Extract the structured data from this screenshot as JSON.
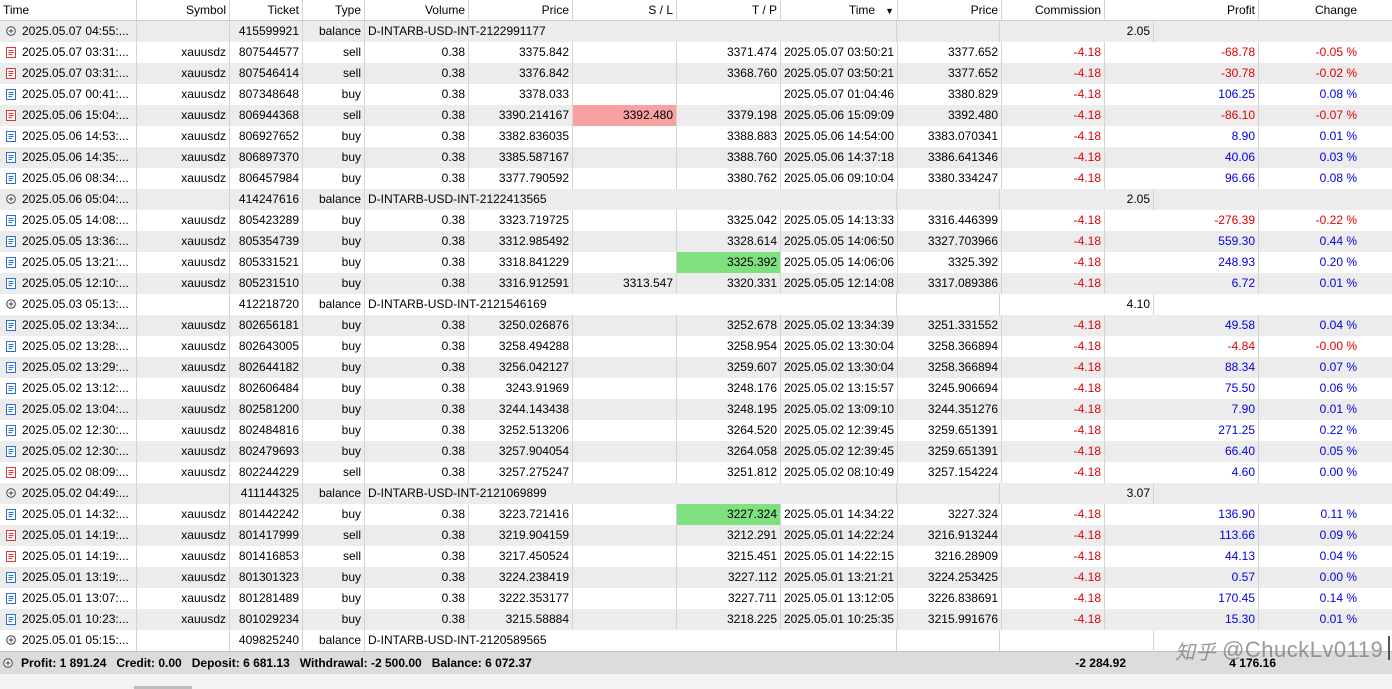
{
  "columns": [
    {
      "key": "time",
      "label": "Time",
      "align": "l"
    },
    {
      "key": "symbol",
      "label": "Symbol",
      "align": "r"
    },
    {
      "key": "ticket",
      "label": "Ticket",
      "align": "r"
    },
    {
      "key": "type",
      "label": "Type",
      "align": "r"
    },
    {
      "key": "volume",
      "label": "Volume",
      "align": "r"
    },
    {
      "key": "price",
      "label": "Price",
      "align": "r"
    },
    {
      "key": "sl",
      "label": "S / L",
      "align": "r"
    },
    {
      "key": "tp",
      "label": "T / P",
      "align": "r"
    },
    {
      "key": "time2",
      "label": "Time",
      "align": "r"
    },
    {
      "key": "price2",
      "label": "Price",
      "align": "r"
    },
    {
      "key": "commission",
      "label": "Commission",
      "align": "r"
    },
    {
      "key": "profit",
      "label": "Profit",
      "align": "r"
    },
    {
      "key": "change",
      "label": "Change",
      "align": "r"
    }
  ],
  "sort_indicator": "▼",
  "colors": {
    "loss": "#e00000",
    "gain": "#0000dd",
    "sl_hit": "#f7a1a1",
    "tp_hit": "#7ee07e",
    "alt_row": "#ececec"
  },
  "rows": [
    {
      "kind": "balance",
      "icon": "plus-circle",
      "time": "2025.05.07 04:55:...",
      "ticket": "415599921",
      "type": "balance",
      "comment": "D-INTARB-USD-INT-2122991177",
      "profit": "2.05"
    },
    {
      "kind": "trade",
      "icon": "sell",
      "time": "2025.05.07 03:31:...",
      "symbol": "xauusdz",
      "ticket": "807544577",
      "type": "sell",
      "volume": "0.38",
      "price": "3375.842",
      "sl": "",
      "tp": "3371.474",
      "time2": "2025.05.07 03:50:21",
      "price2": "3377.652",
      "commission": "-4.18",
      "profit": "-68.78",
      "change": "-0.05 %"
    },
    {
      "kind": "trade",
      "icon": "sell",
      "time": "2025.05.07 03:31:...",
      "symbol": "xauusdz",
      "ticket": "807546414",
      "type": "sell",
      "volume": "0.38",
      "price": "3376.842",
      "sl": "",
      "tp": "3368.760",
      "time2": "2025.05.07 03:50:21",
      "price2": "3377.652",
      "commission": "-4.18",
      "profit": "-30.78",
      "change": "-0.02 %"
    },
    {
      "kind": "trade",
      "icon": "buy",
      "time": "2025.05.07 00:41:...",
      "symbol": "xauusdz",
      "ticket": "807348648",
      "type": "buy",
      "volume": "0.38",
      "price": "3378.033",
      "sl": "",
      "tp": "",
      "time2": "2025.05.07 01:04:46",
      "price2": "3380.829",
      "commission": "-4.18",
      "profit": "106.25",
      "change": "0.08 %"
    },
    {
      "kind": "trade",
      "icon": "sell",
      "time": "2025.05.06 15:04:...",
      "symbol": "xauusdz",
      "ticket": "806944368",
      "type": "sell",
      "volume": "0.38",
      "price": "3390.214167",
      "sl": "3392.480",
      "sl_hit": true,
      "tp": "3379.198",
      "time2": "2025.05.06 15:09:09",
      "price2": "3392.480",
      "commission": "-4.18",
      "profit": "-86.10",
      "change": "-0.07 %"
    },
    {
      "kind": "trade",
      "icon": "buy",
      "time": "2025.05.06 14:53:...",
      "symbol": "xauusdz",
      "ticket": "806927652",
      "type": "buy",
      "volume": "0.38",
      "price": "3382.836035",
      "sl": "",
      "tp": "3388.883",
      "time2": "2025.05.06 14:54:00",
      "price2": "3383.070341",
      "commission": "-4.18",
      "profit": "8.90",
      "change": "0.01 %"
    },
    {
      "kind": "trade",
      "icon": "buy",
      "time": "2025.05.06 14:35:...",
      "symbol": "xauusdz",
      "ticket": "806897370",
      "type": "buy",
      "volume": "0.38",
      "price": "3385.587167",
      "sl": "",
      "tp": "3388.760",
      "time2": "2025.05.06 14:37:18",
      "price2": "3386.641346",
      "commission": "-4.18",
      "profit": "40.06",
      "change": "0.03 %"
    },
    {
      "kind": "trade",
      "icon": "buy",
      "time": "2025.05.06 08:34:...",
      "symbol": "xauusdz",
      "ticket": "806457984",
      "type": "buy",
      "volume": "0.38",
      "price": "3377.790592",
      "sl": "",
      "tp": "3380.762",
      "time2": "2025.05.06 09:10:04",
      "price2": "3380.334247",
      "commission": "-4.18",
      "profit": "96.66",
      "change": "0.08 %"
    },
    {
      "kind": "balance",
      "icon": "plus-circle",
      "time": "2025.05.06 05:04:...",
      "ticket": "414247616",
      "type": "balance",
      "comment": "D-INTARB-USD-INT-2122413565",
      "profit": "2.05"
    },
    {
      "kind": "trade",
      "icon": "buy",
      "time": "2025.05.05 14:08:...",
      "symbol": "xauusdz",
      "ticket": "805423289",
      "type": "buy",
      "volume": "0.38",
      "price": "3323.719725",
      "sl": "",
      "tp": "3325.042",
      "time2": "2025.05.05 14:13:33",
      "price2": "3316.446399",
      "commission": "-4.18",
      "profit": "-276.39",
      "change": "-0.22 %"
    },
    {
      "kind": "trade",
      "icon": "buy",
      "time": "2025.05.05 13:36:...",
      "symbol": "xauusdz",
      "ticket": "805354739",
      "type": "buy",
      "volume": "0.38",
      "price": "3312.985492",
      "sl": "",
      "tp": "3328.614",
      "time2": "2025.05.05 14:06:50",
      "price2": "3327.703966",
      "commission": "-4.18",
      "profit": "559.30",
      "change": "0.44 %"
    },
    {
      "kind": "trade",
      "icon": "buy",
      "time": "2025.05.05 13:21:...",
      "symbol": "xauusdz",
      "ticket": "805331521",
      "type": "buy",
      "volume": "0.38",
      "price": "3318.841229",
      "sl": "",
      "tp": "3325.392",
      "tp_hit": true,
      "time2": "2025.05.05 14:06:06",
      "price2": "3325.392",
      "commission": "-4.18",
      "profit": "248.93",
      "change": "0.20 %"
    },
    {
      "kind": "trade",
      "icon": "buy",
      "time": "2025.05.05 12:10:...",
      "symbol": "xauusdz",
      "ticket": "805231510",
      "type": "buy",
      "volume": "0.38",
      "price": "3316.912591",
      "sl": "3313.547",
      "tp": "3320.331",
      "time2": "2025.05.05 12:14:08",
      "price2": "3317.089386",
      "commission": "-4.18",
      "profit": "6.72",
      "change": "0.01 %"
    },
    {
      "kind": "balance",
      "icon": "plus-circle",
      "time": "2025.05.03 05:13:...",
      "ticket": "412218720",
      "type": "balance",
      "comment": "D-INTARB-USD-INT-2121546169",
      "profit": "4.10"
    },
    {
      "kind": "trade",
      "icon": "buy",
      "time": "2025.05.02 13:34:...",
      "symbol": "xauusdz",
      "ticket": "802656181",
      "type": "buy",
      "volume": "0.38",
      "price": "3250.026876",
      "sl": "",
      "tp": "3252.678",
      "time2": "2025.05.02 13:34:39",
      "price2": "3251.331552",
      "commission": "-4.18",
      "profit": "49.58",
      "change": "0.04 %"
    },
    {
      "kind": "trade",
      "icon": "buy",
      "time": "2025.05.02 13:28:...",
      "symbol": "xauusdz",
      "ticket": "802643005",
      "type": "buy",
      "volume": "0.38",
      "price": "3258.494288",
      "sl": "",
      "tp": "3258.954",
      "time2": "2025.05.02 13:30:04",
      "price2": "3258.366894",
      "commission": "-4.18",
      "profit": "-4.84",
      "change": "-0.00 %"
    },
    {
      "kind": "trade",
      "icon": "buy",
      "time": "2025.05.02 13:29:...",
      "symbol": "xauusdz",
      "ticket": "802644182",
      "type": "buy",
      "volume": "0.38",
      "price": "3256.042127",
      "sl": "",
      "tp": "3259.607",
      "time2": "2025.05.02 13:30:04",
      "price2": "3258.366894",
      "commission": "-4.18",
      "profit": "88.34",
      "change": "0.07 %"
    },
    {
      "kind": "trade",
      "icon": "buy",
      "time": "2025.05.02 13:12:...",
      "symbol": "xauusdz",
      "ticket": "802606484",
      "type": "buy",
      "volume": "0.38",
      "price": "3243.91969",
      "sl": "",
      "tp": "3248.176",
      "time2": "2025.05.02 13:15:57",
      "price2": "3245.906694",
      "commission": "-4.18",
      "profit": "75.50",
      "change": "0.06 %"
    },
    {
      "kind": "trade",
      "icon": "buy",
      "time": "2025.05.02 13:04:...",
      "symbol": "xauusdz",
      "ticket": "802581200",
      "type": "buy",
      "volume": "0.38",
      "price": "3244.143438",
      "sl": "",
      "tp": "3248.195",
      "time2": "2025.05.02 13:09:10",
      "price2": "3244.351276",
      "commission": "-4.18",
      "profit": "7.90",
      "change": "0.01 %"
    },
    {
      "kind": "trade",
      "icon": "buy",
      "time": "2025.05.02 12:30:...",
      "symbol": "xauusdz",
      "ticket": "802484816",
      "type": "buy",
      "volume": "0.38",
      "price": "3252.513206",
      "sl": "",
      "tp": "3264.520",
      "time2": "2025.05.02 12:39:45",
      "price2": "3259.651391",
      "commission": "-4.18",
      "profit": "271.25",
      "change": "0.22 %"
    },
    {
      "kind": "trade",
      "icon": "buy",
      "time": "2025.05.02 12:30:...",
      "symbol": "xauusdz",
      "ticket": "802479693",
      "type": "buy",
      "volume": "0.38",
      "price": "3257.904054",
      "sl": "",
      "tp": "3264.058",
      "time2": "2025.05.02 12:39:45",
      "price2": "3259.651391",
      "commission": "-4.18",
      "profit": "66.40",
      "change": "0.05 %"
    },
    {
      "kind": "trade",
      "icon": "sell",
      "time": "2025.05.02 08:09:...",
      "symbol": "xauusdz",
      "ticket": "802244229",
      "type": "sell",
      "volume": "0.38",
      "price": "3257.275247",
      "sl": "",
      "tp": "3251.812",
      "time2": "2025.05.02 08:10:49",
      "price2": "3257.154224",
      "commission": "-4.18",
      "profit": "4.60",
      "change": "0.00 %"
    },
    {
      "kind": "balance",
      "icon": "plus-circle",
      "time": "2025.05.02 04:49:...",
      "ticket": "411144325",
      "type": "balance",
      "comment": "D-INTARB-USD-INT-2121069899",
      "profit": "3.07"
    },
    {
      "kind": "trade",
      "icon": "buy",
      "time": "2025.05.01 14:32:...",
      "symbol": "xauusdz",
      "ticket": "801442242",
      "type": "buy",
      "volume": "0.38",
      "price": "3223.721416",
      "sl": "",
      "tp": "3227.324",
      "tp_hit": true,
      "time2": "2025.05.01 14:34:22",
      "price2": "3227.324",
      "commission": "-4.18",
      "profit": "136.90",
      "change": "0.11 %"
    },
    {
      "kind": "trade",
      "icon": "sell",
      "time": "2025.05.01 14:19:...",
      "symbol": "xauusdz",
      "ticket": "801417999",
      "type": "sell",
      "volume": "0.38",
      "price": "3219.904159",
      "sl": "",
      "tp": "3212.291",
      "time2": "2025.05.01 14:22:24",
      "price2": "3216.913244",
      "commission": "-4.18",
      "profit": "113.66",
      "change": "0.09 %"
    },
    {
      "kind": "trade",
      "icon": "sell",
      "time": "2025.05.01 14:19:...",
      "symbol": "xauusdz",
      "ticket": "801416853",
      "type": "sell",
      "volume": "0.38",
      "price": "3217.450524",
      "sl": "",
      "tp": "3215.451",
      "time2": "2025.05.01 14:22:15",
      "price2": "3216.28909",
      "commission": "-4.18",
      "profit": "44.13",
      "change": "0.04 %"
    },
    {
      "kind": "trade",
      "icon": "buy",
      "time": "2025.05.01 13:19:...",
      "symbol": "xauusdz",
      "ticket": "801301323",
      "type": "buy",
      "volume": "0.38",
      "price": "3224.238419",
      "sl": "",
      "tp": "3227.112",
      "time2": "2025.05.01 13:21:21",
      "price2": "3224.253425",
      "commission": "-4.18",
      "profit": "0.57",
      "change": "0.00 %"
    },
    {
      "kind": "trade",
      "icon": "buy",
      "time": "2025.05.01 13:07:...",
      "symbol": "xauusdz",
      "ticket": "801281489",
      "type": "buy",
      "volume": "0.38",
      "price": "3222.353177",
      "sl": "",
      "tp": "3227.711",
      "time2": "2025.05.01 13:12:05",
      "price2": "3226.838691",
      "commission": "-4.18",
      "profit": "170.45",
      "change": "0.14 %"
    },
    {
      "kind": "trade",
      "icon": "buy",
      "time": "2025.05.01 10:23:...",
      "symbol": "xauusdz",
      "ticket": "801029234",
      "symbol2": "",
      "type": "buy",
      "volume": "0.38",
      "price": "3215.58884",
      "sl": "",
      "tp": "3218.225",
      "time2": "2025.05.01 10:25:35",
      "price2": "3215.991676",
      "commission": "-4.18",
      "profit": "15.30",
      "change": "0.01 %"
    },
    {
      "kind": "balance",
      "icon": "plus-circle",
      "time": "2025.05.01 05:15:...",
      "ticket": "409825240",
      "type": "balance",
      "comment": "D-INTARB-USD-INT-2120589565",
      "profit": ""
    }
  ],
  "footer": {
    "summary": "Profit: 1 891.24   Credit: 0.00   Deposit: 6 681.13   Withdrawal: -2 500.00   Balance: 6 072.37",
    "commission_total": "-2 284.92",
    "profit_total": "4 176.16"
  },
  "watermark": {
    "logo": "知乎",
    "text": "@ChuckLv0119"
  }
}
